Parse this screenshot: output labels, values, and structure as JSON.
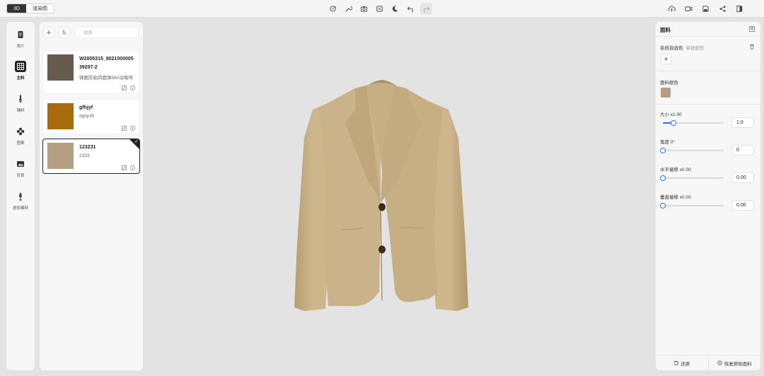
{
  "topbar": {
    "mode_tabs": [
      {
        "label": "3D",
        "active": true
      },
      {
        "label": "渲染图",
        "active": false
      }
    ],
    "center_tools": [
      "rotate-icon",
      "wrench-icon",
      "camera-icon",
      "fit-view-icon",
      "moon-icon",
      "undo-icon",
      "redo-icon"
    ],
    "right_tools": [
      "cloud-upload-icon",
      "video-icon",
      "save-icon",
      "share-icon",
      "exit-icon"
    ]
  },
  "leftnav": {
    "items": [
      {
        "label": "简介",
        "icon": "document-icon",
        "active": false
      },
      {
        "label": "主料",
        "icon": "fabric-grid-icon",
        "active": true
      },
      {
        "label": "辅料",
        "icon": "zipper-icon",
        "active": false
      },
      {
        "label": "图案",
        "icon": "pattern-icon",
        "active": false
      },
      {
        "label": "背景",
        "icon": "image-icon",
        "active": false
      },
      {
        "label": "虚拟模特",
        "icon": "mannequin-icon",
        "active": false
      }
    ]
  },
  "fabric_panel": {
    "search_placeholder": "搜索",
    "cards": [
      {
        "name": "W2005315_8021000005\n39297-2",
        "desc": "锦氨防粘四面弹56#深咖啡",
        "swatch": "#675a4e",
        "selected": false
      },
      {
        "name": "gfhjyf",
        "desc": "dghjnfh",
        "swatch": "#a86b0c",
        "selected": false
      },
      {
        "name": "123231",
        "desc": "2333",
        "swatch": "#b59e82",
        "selected": true
      }
    ]
  },
  "garment": {
    "fabric_color": "#c9b289",
    "shadow_color": "#a89069",
    "button_color": "#3d2a1c"
  },
  "right_panel": {
    "title": "面料",
    "custom_color_label": "系统自选色",
    "custom_color_sub": "单款配色",
    "fabric_color_label": "面料颜色",
    "fabric_color": "#b59e82",
    "sliders": [
      {
        "label": "大小 x1.00",
        "value": "1.0",
        "fraction": 0.18
      },
      {
        "label": "角度 0°",
        "value": "0",
        "fraction": 0.0
      },
      {
        "label": "水平偏移 x0.00",
        "value": "0.00",
        "fraction": 0.0
      },
      {
        "label": "垂直偏移 x0.00",
        "value": "0.00",
        "fraction": 0.0
      }
    ],
    "footer": {
      "restore_label": "还原",
      "restore_original_label": "恢复原始面料"
    }
  },
  "colors": {
    "accent": "#2f6fed",
    "dark": "#222222"
  }
}
